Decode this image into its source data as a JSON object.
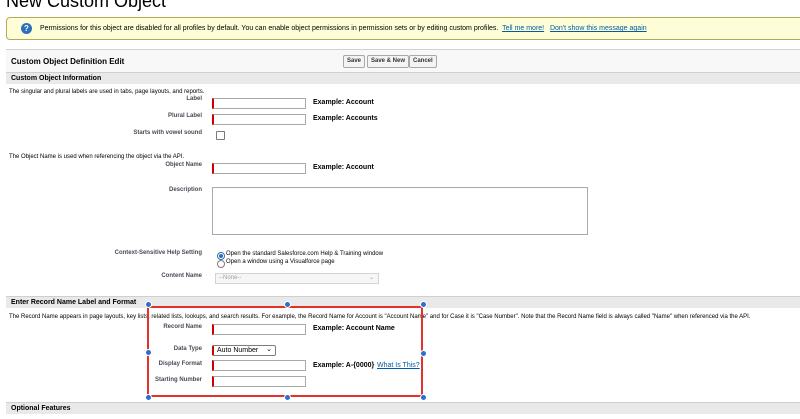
{
  "page": {
    "title": "New Custom Object"
  },
  "banner": {
    "icon": "info-icon",
    "message": "Permissions for this object are disabled for all profiles by default. You can enable object permissions in permission sets or by editing custom profiles.",
    "link_tell_me_more": "Tell me more!",
    "link_dont_show": "Don't show this message again"
  },
  "edit_block": {
    "title": "Custom Object Definition Edit",
    "buttons": {
      "save": "Save",
      "save_new": "Save & New",
      "cancel": "Cancel"
    }
  },
  "custom_object_info": {
    "header": "Custom Object Information",
    "labels_note": "The singular and plural labels are used in tabs, page layouts, and reports.",
    "label": {
      "label": "Label",
      "value": "",
      "example": "Example:  Account"
    },
    "plural_label": {
      "label": "Plural Label",
      "value": "",
      "example": "Example:  Accounts"
    },
    "vowel_sound": {
      "label": "Starts with vowel sound",
      "checked": false
    },
    "api_note": "The Object Name is used when referencing the object via the API.",
    "object_name": {
      "label": "Object Name",
      "value": "",
      "example": "Example:  Account"
    },
    "description": {
      "label": "Description",
      "value": ""
    },
    "help_setting": {
      "label": "Context-Sensitive Help Setting",
      "option1": "Open the standard Salesforce.com Help & Training window",
      "option2": "Open a window using a Visualforce page",
      "selected": "option1"
    },
    "content_name": {
      "label": "Content Name",
      "value": "--None--"
    }
  },
  "record_name": {
    "header": "Enter Record Name Label and Format",
    "note": "The Record Name appears in page layouts, key lists, related lists, lookups, and search results. For example, the Record Name for Account is \"Account Name\" and for Case it is \"Case Number\". Note that the Record Name field is always called \"Name\" when referenced via the API.",
    "record_name_field": {
      "label": "Record Name",
      "value": "",
      "example": "Example:  Account Name"
    },
    "data_type": {
      "label": "Data Type",
      "value": "Auto Number"
    },
    "display_format": {
      "label": "Display Format",
      "value": "",
      "example": "Example:  A-{0000}",
      "help_link": "What Is This?"
    },
    "starting_number": {
      "label": "Starting Number",
      "value": ""
    }
  },
  "optional_features": {
    "header": "Optional Features"
  },
  "colors": {
    "selection": "#e4322a",
    "handle": "#2d6fd1",
    "required": "#cc0000",
    "banner_bg": "#fdfdd8",
    "link": "#015ba7"
  }
}
